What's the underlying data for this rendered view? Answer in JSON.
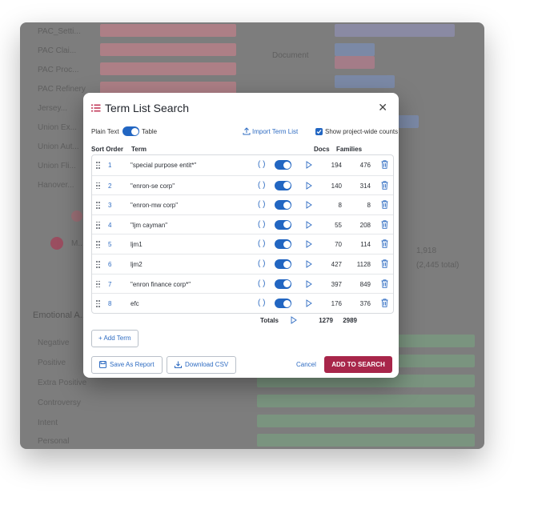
{
  "background": {
    "labels": [
      "PAC_Setti...",
      "PAC Clai...",
      "PAC Proc...",
      "PAC Refinery",
      "Jersey...",
      "Union Ex...",
      "Union Aut...",
      "Union Fli...",
      "Hanover...",
      "Emotional A...",
      "Negative",
      "Positive",
      "Extra Positive",
      "Controversy",
      "Intent",
      "Personal"
    ],
    "right_labels": [
      "Document",
      "1,918",
      "(2,445 total)"
    ],
    "legend_item": "M..."
  },
  "modal": {
    "title": "Term List Search",
    "close_label": "✕",
    "plain_text_label": "Plain Text",
    "table_label": "Table",
    "import_label": "Import Term List",
    "show_counts_label": "Show project-wide counts",
    "headers": {
      "sort_order": "Sort Order",
      "term": "Term",
      "docs": "Docs",
      "families": "Families"
    },
    "rows": [
      {
        "order": "1",
        "term": "\"special purpose entit*\"",
        "docs": "194",
        "families": "476"
      },
      {
        "order": "2",
        "term": "\"enron-se corp\"",
        "docs": "140",
        "families": "314"
      },
      {
        "order": "3",
        "term": "\"enron-mw corp\"",
        "docs": "8",
        "families": "8"
      },
      {
        "order": "4",
        "term": "\"ljm cayman\"",
        "docs": "55",
        "families": "208"
      },
      {
        "order": "5",
        "term": "ljm1",
        "docs": "70",
        "families": "114"
      },
      {
        "order": "6",
        "term": "ljm2",
        "docs": "427",
        "families": "1128"
      },
      {
        "order": "7",
        "term": "\"enron finance corp*\"",
        "docs": "397",
        "families": "849"
      },
      {
        "order": "8",
        "term": "efc",
        "docs": "176",
        "families": "376"
      }
    ],
    "paren_symbol": "( )",
    "totals": {
      "label": "Totals",
      "docs": "1279",
      "families": "2989"
    },
    "add_term_label": "+ Add Term",
    "save_report_label": "Save As Report",
    "download_csv_label": "Download CSV",
    "cancel_label": "Cancel",
    "search_label": "ADD TO SEARCH"
  },
  "colors": {
    "accent_blue": "#2266c2",
    "primary_button": "#a8264a",
    "overlay": "#7d7d7d"
  }
}
